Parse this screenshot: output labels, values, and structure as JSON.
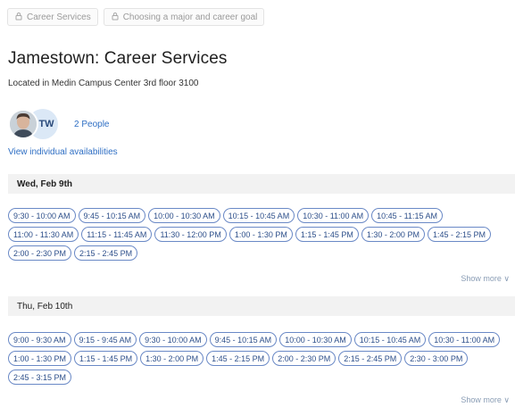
{
  "breadcrumbs": [
    {
      "label": "Career Services"
    },
    {
      "label": "Choosing a major and career goal"
    }
  ],
  "page": {
    "title": "Jamestown: Career Services",
    "location": "Located in Medin Campus Center 3rd floor 3100"
  },
  "people": {
    "initials": "TW",
    "count_label": "2 People",
    "view_link": "View individual availabilities"
  },
  "days": [
    {
      "label": "Wed, Feb 9th",
      "slots": [
        "9:30 - 10:00 AM",
        "9:45 - 10:15 AM",
        "10:00 - 10:30 AM",
        "10:15 - 10:45 AM",
        "10:30 - 11:00 AM",
        "10:45 - 11:15 AM",
        "11:00 - 11:30 AM",
        "11:15 - 11:45 AM",
        "11:30 - 12:00 PM",
        "1:00 - 1:30 PM",
        "1:15 - 1:45 PM",
        "1:30 - 2:00 PM",
        "1:45 - 2:15 PM",
        "2:00 - 2:30 PM",
        "2:15 - 2:45 PM"
      ],
      "show_more": "Show more"
    },
    {
      "label": "Thu, Feb 10th",
      "slots": [
        "9:00 - 9:30 AM",
        "9:15 - 9:45 AM",
        "9:30 - 10:00 AM",
        "9:45 - 10:15 AM",
        "10:00 - 10:30 AM",
        "10:15 - 10:45 AM",
        "10:30 - 11:00 AM",
        "1:00 - 1:30 PM",
        "1:15 - 1:45 PM",
        "1:30 - 2:00 PM",
        "1:45 - 2:15 PM",
        "2:00 - 2:30 PM",
        "2:15 - 2:45 PM",
        "2:30 - 3:00 PM",
        "2:45 - 3:15 PM"
      ],
      "show_more": "Show more"
    }
  ],
  "colors": {
    "link": "#2f6fc4",
    "slot_border": "#6a89c6",
    "day_header_bg": "#f2f2f2"
  }
}
